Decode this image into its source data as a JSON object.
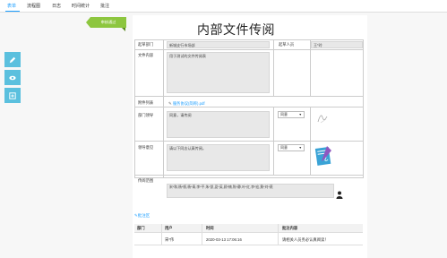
{
  "tabs": [
    {
      "label": "表单"
    },
    {
      "label": "流程图"
    },
    {
      "label": "日志"
    },
    {
      "label": "时间统计"
    },
    {
      "label": "批注"
    }
  ],
  "ribbon": {
    "label": "审核通过"
  },
  "title": "内部文件传阅",
  "form": {
    "dept_label": "起草部门",
    "dept_value": "新城支行市场部",
    "drafter_label": "起草人员",
    "drafter_value": "王*玲",
    "content_label": "文件内容",
    "content_value": "用于测试的文件传阅表",
    "attach_label": "附件列表",
    "attach_value": "服务协议(简称).pdf",
    "dept_lead_label": "部门领导",
    "dept_lead_opinion": "同意，请传阅",
    "dept_lead_select": "同意",
    "leader_label": "领导意见",
    "leader_opinion": "请以下同志认真传阅。",
    "leader_select": "同意",
    "circulate_label": "传阅范围",
    "circulate_value": "宋*和,杨*帆,杨*青,李*平,朱*凯,夏*英,顾*楠,陈*静,叶*红,李*宏,黄*刘*燕"
  },
  "comments": {
    "link_label": "批注区",
    "headers": [
      "部门",
      "用户",
      "时间",
      "批注内容"
    ],
    "rows": [
      {
        "dept": "",
        "user": "宋*伟",
        "time": "2020-03-13 17:06:16",
        "content": "请相关人员务必认真阅读！"
      }
    ]
  },
  "icons": {
    "edit": "pencil-icon",
    "view": "eye-icon",
    "add": "plus-square-icon"
  }
}
